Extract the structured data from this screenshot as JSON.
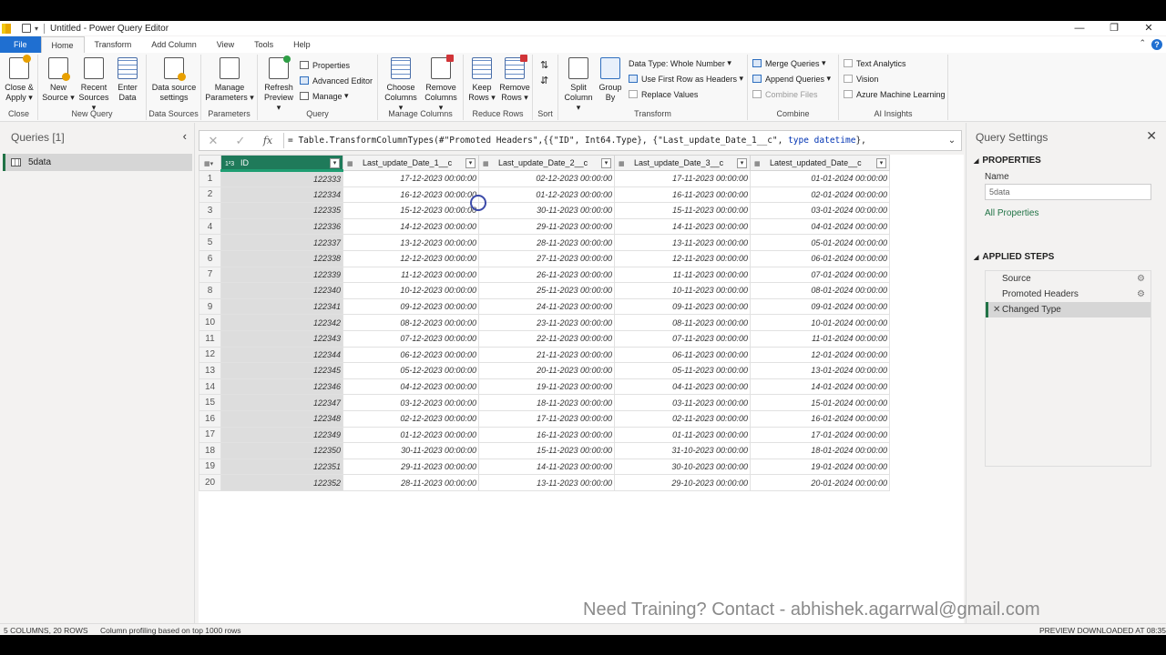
{
  "window": {
    "title": "Untitled - Power Query Editor"
  },
  "tabs": [
    "File",
    "Home",
    "Transform",
    "Add Column",
    "View",
    "Tools",
    "Help"
  ],
  "ribbon": {
    "close": {
      "btn1": "Close &",
      "btn2": "Apply",
      "label": "Close"
    },
    "new_query": {
      "new1": "New",
      "new2": "Source",
      "recent1": "Recent",
      "recent2": "Sources",
      "enter1": "Enter",
      "enter2": "Data",
      "label": "New Query"
    },
    "data_sources": {
      "btn1": "Data source",
      "btn2": "settings",
      "label": "Data Sources"
    },
    "parameters": {
      "btn1": "Manage",
      "btn2": "Parameters",
      "label": "Parameters"
    },
    "query": {
      "refresh1": "Refresh",
      "refresh2": "Preview",
      "properties": "Properties",
      "advanced": "Advanced Editor",
      "manage": "Manage",
      "label": "Query"
    },
    "manage_columns": {
      "choose1": "Choose",
      "choose2": "Columns",
      "remove1": "Remove",
      "remove2": "Columns",
      "label": "Manage Columns"
    },
    "reduce_rows": {
      "keep1": "Keep",
      "keep2": "Rows",
      "remove1": "Remove",
      "remove2": "Rows",
      "label": "Reduce Rows"
    },
    "sort": {
      "label": "Sort"
    },
    "transform": {
      "split1": "Split",
      "split2": "Column",
      "group1": "Group",
      "group2": "By",
      "datatype": "Data Type: Whole Number",
      "firstrow": "Use First Row as Headers",
      "replace": "Replace Values",
      "label": "Transform"
    },
    "combine": {
      "merge": "Merge Queries",
      "append": "Append Queries",
      "files": "Combine Files",
      "label": "Combine"
    },
    "ai": {
      "text": "Text Analytics",
      "vision": "Vision",
      "azure": "Azure Machine Learning",
      "label": "AI Insights"
    }
  },
  "queries": {
    "title": "Queries [1]",
    "items": [
      "5data"
    ]
  },
  "formula": {
    "prefix": "= Table.TransformColumnTypes(#\"Promoted Headers\",{{\"ID\", Int64.Type}, {\"Last_update_Date_1__c\", ",
    "kw": "type datetime",
    "suffix": "},"
  },
  "table": {
    "columns": [
      {
        "type": "1²3",
        "name": "ID"
      },
      {
        "type": "▦",
        "name": "Last_update_Date_1__c"
      },
      {
        "type": "▦",
        "name": "Last_update_Date_2__c"
      },
      {
        "type": "▦",
        "name": "Last_update_Date_3__c"
      },
      {
        "type": "▦",
        "name": "Latest_updated_Date__c"
      }
    ],
    "rows": [
      [
        "1",
        "122333",
        "17-12-2023 00:00:00",
        "02-12-2023 00:00:00",
        "17-11-2023 00:00:00",
        "01-01-2024 00:00:00"
      ],
      [
        "2",
        "122334",
        "16-12-2023 00:00:00",
        "01-12-2023 00:00:00",
        "16-11-2023 00:00:00",
        "02-01-2024 00:00:00"
      ],
      [
        "3",
        "122335",
        "15-12-2023 00:00:00",
        "30-11-2023 00:00:00",
        "15-11-2023 00:00:00",
        "03-01-2024 00:00:00"
      ],
      [
        "4",
        "122336",
        "14-12-2023 00:00:00",
        "29-11-2023 00:00:00",
        "14-11-2023 00:00:00",
        "04-01-2024 00:00:00"
      ],
      [
        "5",
        "122337",
        "13-12-2023 00:00:00",
        "28-11-2023 00:00:00",
        "13-11-2023 00:00:00",
        "05-01-2024 00:00:00"
      ],
      [
        "6",
        "122338",
        "12-12-2023 00:00:00",
        "27-11-2023 00:00:00",
        "12-11-2023 00:00:00",
        "06-01-2024 00:00:00"
      ],
      [
        "7",
        "122339",
        "11-12-2023 00:00:00",
        "26-11-2023 00:00:00",
        "11-11-2023 00:00:00",
        "07-01-2024 00:00:00"
      ],
      [
        "8",
        "122340",
        "10-12-2023 00:00:00",
        "25-11-2023 00:00:00",
        "10-11-2023 00:00:00",
        "08-01-2024 00:00:00"
      ],
      [
        "9",
        "122341",
        "09-12-2023 00:00:00",
        "24-11-2023 00:00:00",
        "09-11-2023 00:00:00",
        "09-01-2024 00:00:00"
      ],
      [
        "10",
        "122342",
        "08-12-2023 00:00:00",
        "23-11-2023 00:00:00",
        "08-11-2023 00:00:00",
        "10-01-2024 00:00:00"
      ],
      [
        "11",
        "122343",
        "07-12-2023 00:00:00",
        "22-11-2023 00:00:00",
        "07-11-2023 00:00:00",
        "11-01-2024 00:00:00"
      ],
      [
        "12",
        "122344",
        "06-12-2023 00:00:00",
        "21-11-2023 00:00:00",
        "06-11-2023 00:00:00",
        "12-01-2024 00:00:00"
      ],
      [
        "13",
        "122345",
        "05-12-2023 00:00:00",
        "20-11-2023 00:00:00",
        "05-11-2023 00:00:00",
        "13-01-2024 00:00:00"
      ],
      [
        "14",
        "122346",
        "04-12-2023 00:00:00",
        "19-11-2023 00:00:00",
        "04-11-2023 00:00:00",
        "14-01-2024 00:00:00"
      ],
      [
        "15",
        "122347",
        "03-12-2023 00:00:00",
        "18-11-2023 00:00:00",
        "03-11-2023 00:00:00",
        "15-01-2024 00:00:00"
      ],
      [
        "16",
        "122348",
        "02-12-2023 00:00:00",
        "17-11-2023 00:00:00",
        "02-11-2023 00:00:00",
        "16-01-2024 00:00:00"
      ],
      [
        "17",
        "122349",
        "01-12-2023 00:00:00",
        "16-11-2023 00:00:00",
        "01-11-2023 00:00:00",
        "17-01-2024 00:00:00"
      ],
      [
        "18",
        "122350",
        "30-11-2023 00:00:00",
        "15-11-2023 00:00:00",
        "31-10-2023 00:00:00",
        "18-01-2024 00:00:00"
      ],
      [
        "19",
        "122351",
        "29-11-2023 00:00:00",
        "14-11-2023 00:00:00",
        "30-10-2023 00:00:00",
        "19-01-2024 00:00:00"
      ],
      [
        "20",
        "122352",
        "28-11-2023 00:00:00",
        "13-11-2023 00:00:00",
        "29-10-2023 00:00:00",
        "20-01-2024 00:00:00"
      ]
    ]
  },
  "settings": {
    "title": "Query Settings",
    "properties": "PROPERTIES",
    "name_label": "Name",
    "name_value": "5data",
    "all_properties": "All Properties",
    "applied_steps": "APPLIED STEPS",
    "steps": [
      "Source",
      "Promoted Headers",
      "Changed Type"
    ]
  },
  "watermark": "Need Training? Contact - abhishek.agarrwal@gmail.com",
  "status": {
    "columns": "5 COLUMNS, 20 ROWS",
    "profiling": "Column profiling based on top 1000 rows",
    "preview": "PREVIEW DOWNLOADED AT 08:35"
  },
  "colors": {
    "accent": "#217346",
    "file_tab": "#1f6fd1",
    "selected_header": "#1f7a5a"
  }
}
